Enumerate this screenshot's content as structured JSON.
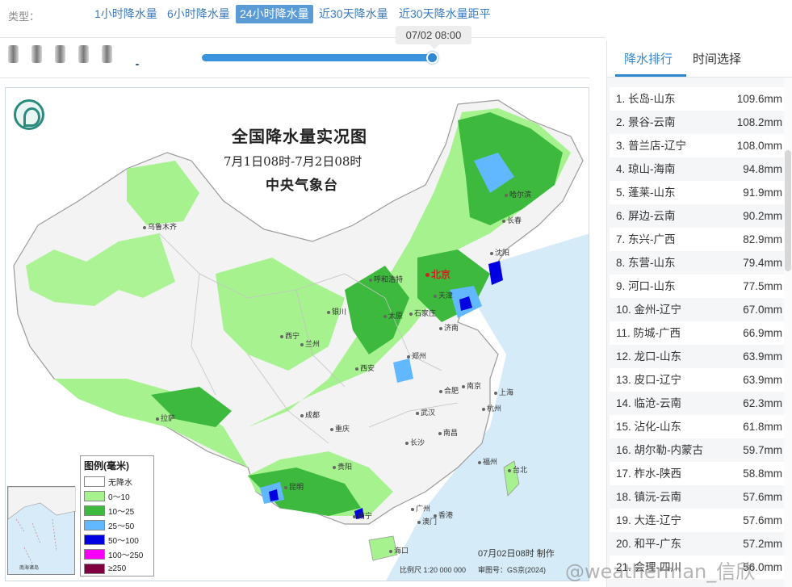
{
  "type_bar": {
    "label": "类型：",
    "options": [
      "1小时降水量",
      "6小时降水量",
      "24小时降水量",
      "近30天降水量",
      "近30天降水量距平"
    ],
    "active_index": 2
  },
  "slider": {
    "time": "07/02 08:00",
    "progress": 1.0
  },
  "map": {
    "title": "全国降水量实况图",
    "subtitle": "7月1日08时-7月2日08时",
    "agency": "中央气象台",
    "cities": [
      "乌鲁木齐",
      "哈尔滨",
      "长春",
      "沈阳",
      "北京",
      "天津",
      "呼和浩特",
      "石家庄",
      "太原",
      "济南",
      "银川",
      "西宁",
      "兰州",
      "郑州",
      "西安",
      "合肥",
      "南京",
      "上海",
      "杭州",
      "武汉",
      "南昌",
      "拉萨",
      "成都",
      "重庆",
      "长沙",
      "贵阳",
      "昆明",
      "福州",
      "台北",
      "南宁",
      "广州",
      "澳门",
      "香港",
      "海口"
    ],
    "legend": {
      "title": "图例(毫米)",
      "items": [
        {
          "label": "无降水",
          "color": "#ffffff"
        },
        {
          "label": "0～10",
          "color": "#a6f28f"
        },
        {
          "label": "10～25",
          "color": "#3dba3d"
        },
        {
          "label": "25～50",
          "color": "#61b8ff"
        },
        {
          "label": "50～100",
          "color": "#0000e1"
        },
        {
          "label": "100～250",
          "color": "#fa00fa"
        },
        {
          "label": "≥250",
          "color": "#800040"
        }
      ]
    },
    "inset_caption": "南海诸岛",
    "made": "07月02日08时 制作",
    "scale": "比例尺 1:20 000 000",
    "review": "审图号：GS京(2024)"
  },
  "panel": {
    "tabs": [
      "降水排行",
      "时间选择"
    ],
    "active_tab": 0,
    "ranking": [
      {
        "name": "1. 长岛-山东",
        "value": "109.6mm"
      },
      {
        "name": "2. 景谷-云南",
        "value": "108.2mm"
      },
      {
        "name": "3. 普兰店-辽宁",
        "value": "108.0mm"
      },
      {
        "name": "4. 琼山-海南",
        "value": "94.8mm"
      },
      {
        "name": "5. 蓬莱-山东",
        "value": "91.9mm"
      },
      {
        "name": "6. 屏边-云南",
        "value": "90.2mm"
      },
      {
        "name": "7. 东兴-广西",
        "value": "82.9mm"
      },
      {
        "name": "8. 东营-山东",
        "value": "79.4mm"
      },
      {
        "name": "9. 河口-山东",
        "value": "77.5mm"
      },
      {
        "name": "10. 金州-辽宁",
        "value": "67.0mm"
      },
      {
        "name": "11. 防城-广西",
        "value": "66.9mm"
      },
      {
        "name": "12. 龙口-山东",
        "value": "63.9mm"
      },
      {
        "name": "13. 皮口-辽宁",
        "value": "63.9mm"
      },
      {
        "name": "14. 临沧-云南",
        "value": "62.3mm"
      },
      {
        "name": "15. 沾化-山东",
        "value": "61.8mm"
      },
      {
        "name": "16. 胡尔勒-内蒙古",
        "value": "59.7mm"
      },
      {
        "name": "17. 柞水-陕西",
        "value": "58.8mm"
      },
      {
        "name": "18. 镇沅-云南",
        "value": "57.6mm"
      },
      {
        "name": "19. 大连-辽宁",
        "value": "57.6mm"
      },
      {
        "name": "20. 和平-广东",
        "value": "57.2mm"
      },
      {
        "name": "21. 会理-四川",
        "value": "56.0mm"
      }
    ]
  },
  "watermark": "@weatherman_信欣",
  "colors": {
    "accent": "#2f87d0",
    "active_type_bg": "#5b9bd5",
    "land": "#f2f2f2",
    "sea": "#cde7f7"
  }
}
